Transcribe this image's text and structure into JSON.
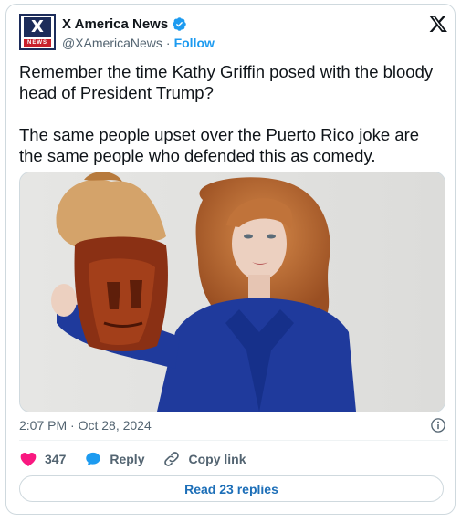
{
  "author": {
    "name": "X America News",
    "handle": "@XAmericaNews",
    "separator": "·",
    "follow_label": "Follow",
    "avatar_letter": "X",
    "avatar_sublabel": "NEWS"
  },
  "tweet": {
    "paragraphs": [
      "Remember the time Kathy Griffin posed with the bloody head of President Trump?",
      "The same people upset over the Puerto Rico joke are the same people who defended this as comedy."
    ]
  },
  "meta": {
    "time": "2:07 PM",
    "separator": "·",
    "date": "Oct 28, 2024"
  },
  "actions": {
    "like_count": "347",
    "reply_label": "Reply",
    "copy_link_label": "Copy link"
  },
  "read_replies_label": "Read 23 replies",
  "colors": {
    "accent": "#1d9bf0",
    "like": "#f91880",
    "text": "#0f1419",
    "muted": "#536471"
  },
  "icons": [
    "verified-badge-icon",
    "x-logo-icon",
    "info-icon",
    "heart-icon",
    "reply-bubble-icon",
    "link-icon"
  ]
}
